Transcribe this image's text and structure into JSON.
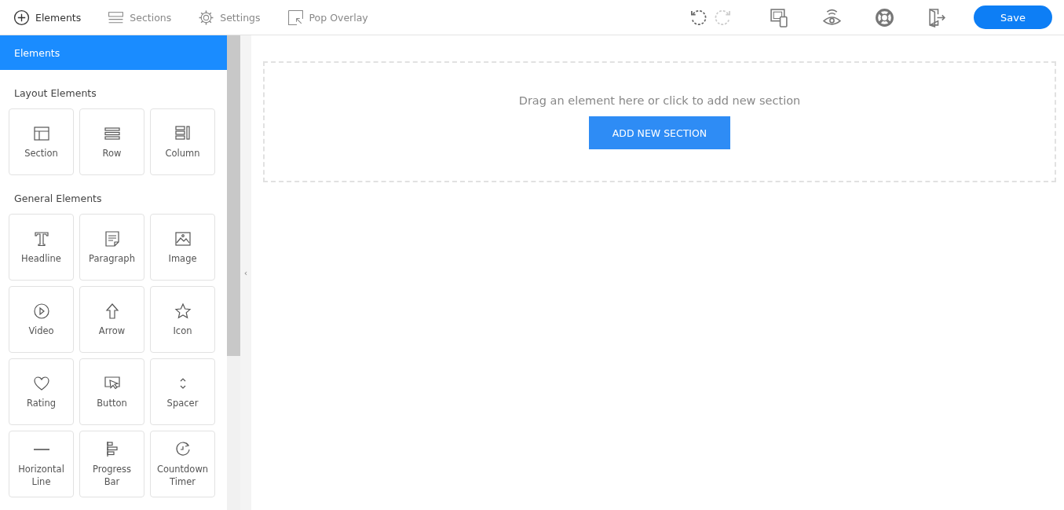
{
  "toolbar": {
    "nav": [
      {
        "label": "Elements",
        "selected": true
      },
      {
        "label": "Sections",
        "selected": false
      },
      {
        "label": "Settings",
        "selected": false
      },
      {
        "label": "Pop Overlay",
        "selected": false
      }
    ],
    "history": [
      {
        "kind": "undo",
        "disabled": false
      },
      {
        "kind": "redo",
        "disabled": true
      }
    ],
    "save": "Save"
  },
  "sidebar": {
    "header": "Elements",
    "groups": [
      {
        "title": "Layout Elements",
        "items": [
          "Section",
          "Row",
          "Column"
        ]
      },
      {
        "title": "General Elements",
        "items": [
          "Headline",
          "Paragraph",
          "Image",
          "Video",
          "Arrow",
          "Icon",
          "Rating",
          "Button",
          "Spacer",
          "Horizontal Line",
          "Progress Bar",
          "Countdown Timer"
        ]
      }
    ]
  },
  "collapse": "‹",
  "canvas": {
    "hint": "Drag an element here or click to add new section",
    "button": "ADD NEW SECTION"
  }
}
